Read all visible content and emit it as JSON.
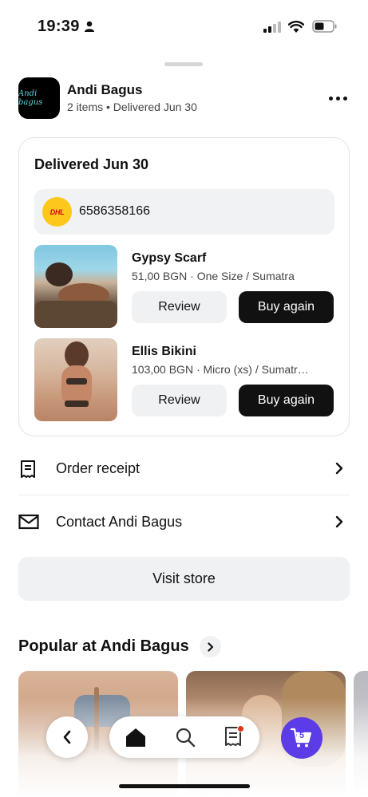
{
  "status_bar": {
    "time": "19:39"
  },
  "store": {
    "logo_text": "Andi bagus",
    "name": "Andi Bagus",
    "subtitle": "2 items • Delivered Jun 30"
  },
  "order": {
    "status": "Delivered Jun 30",
    "carrier_logo_text": "DHL",
    "tracking_number": "6586358166",
    "items": [
      {
        "name": "Gypsy Scarf",
        "meta": "51,00 BGN · One Size / Sumatra",
        "review_label": "Review",
        "buy_label": "Buy again"
      },
      {
        "name": "Ellis Bikini",
        "meta": "103,00 BGN · Micro (xs) / Sumatr…",
        "review_label": "Review",
        "buy_label": "Buy again"
      }
    ]
  },
  "links": {
    "receipt_label": "Order receipt",
    "contact_label": "Contact Andi Bagus"
  },
  "visit_store_label": "Visit store",
  "popular": {
    "title": "Popular at Andi Bagus"
  },
  "nav": {
    "cart_count": "5"
  },
  "colors": {
    "accent": "#5b3ce6",
    "dhl_yellow": "#fcc81b",
    "dhl_red": "#d40511",
    "badge_red": "#e0331a"
  }
}
